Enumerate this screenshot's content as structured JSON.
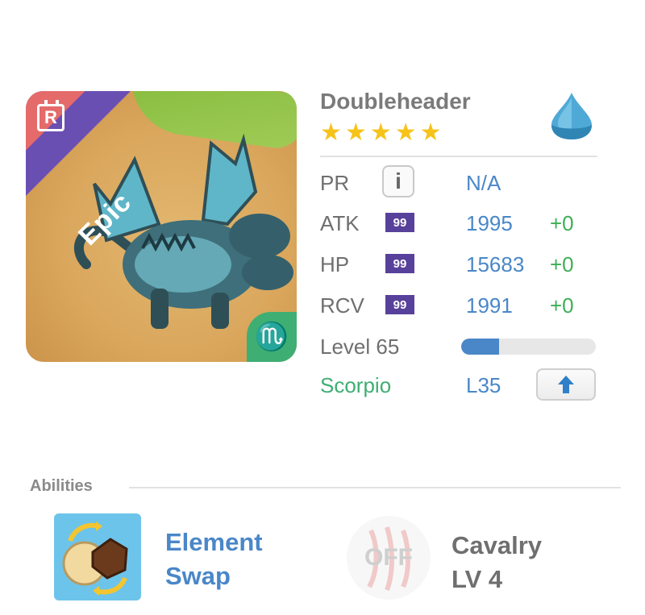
{
  "monster": {
    "name": "Doubleheader",
    "stars": 5,
    "rarity": "Epic",
    "rarity_badge": "R",
    "element": "water",
    "zodiac_symbol": "♏"
  },
  "stats": {
    "pr_label": "PR",
    "pr_value": "N/A",
    "info_icon_text": "i",
    "atk_label": "ATK",
    "atk_level": "99",
    "atk_value": "1995",
    "atk_bonus": "+0",
    "hp_label": "HP",
    "hp_level": "99",
    "hp_value": "15683",
    "hp_bonus": "+0",
    "rcv_label": "RCV",
    "rcv_level": "99",
    "rcv_value": "1991",
    "rcv_bonus": "+0",
    "level_label": "Level 65",
    "level_progress": 0.28,
    "zodiac_label": "Scorpio",
    "zodiac_level": "L35"
  },
  "abilities": {
    "title": "Abilities",
    "active_line1": "Element",
    "active_line2": "Swap",
    "passive_status": "OFF",
    "passive_line1": "Cavalry",
    "passive_line2": "LV 4"
  },
  "colors": {
    "accent_blue": "#4a87c8",
    "bonus_green": "#3fae55",
    "zodiac_green": "#3fae73",
    "star_gold": "#f5c31a",
    "level_purple": "#58419b",
    "epic_red": "#e56a6a"
  }
}
